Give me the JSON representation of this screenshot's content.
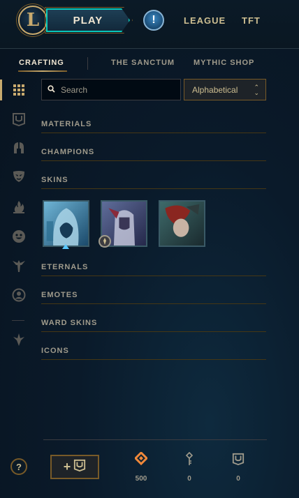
{
  "topbar": {
    "logo_letter": "L",
    "play_label": "PLAY",
    "alert_icon": "exclamation-icon",
    "links": [
      "LEAGUE",
      "TFT"
    ]
  },
  "subnav": {
    "tabs": [
      "CRAFTING",
      "THE SANCTUM",
      "MYTHIC SHOP"
    ],
    "active": "CRAFTING"
  },
  "sidebar": {
    "icons": [
      "grid-icon",
      "chest-icon",
      "helmet-icon",
      "mask-icon",
      "flame-icon",
      "emote-face-icon",
      "ward-icon",
      "profile-icon",
      "rune-icon"
    ]
  },
  "search": {
    "placeholder": "Search",
    "value": ""
  },
  "sort": {
    "selected": "Alphabetical"
  },
  "sections": [
    "MATERIALS",
    "CHAMPIONS",
    "SKINS",
    "ETERNALS",
    "EMOTES",
    "WARD SKINS",
    "ICONS"
  ],
  "skins": [
    {
      "name": "hooded-skin-shard",
      "icon": "rarity-triangle-icon"
    },
    {
      "name": "armored-skin-shard",
      "icon": "legacy-badge-icon"
    },
    {
      "name": "red-hair-skin-shard",
      "icon": ""
    }
  ],
  "footer": {
    "help_label": "?",
    "add_label": "+",
    "currencies": [
      {
        "icon": "orange-essence-icon",
        "value": "500"
      },
      {
        "icon": "key-fragment-icon",
        "value": "0"
      },
      {
        "icon": "chest-icon",
        "value": "0"
      }
    ]
  },
  "colors": {
    "gold": "#c8aa6e",
    "teal": "#0ac8b9",
    "essence_orange": "#f0883a"
  }
}
